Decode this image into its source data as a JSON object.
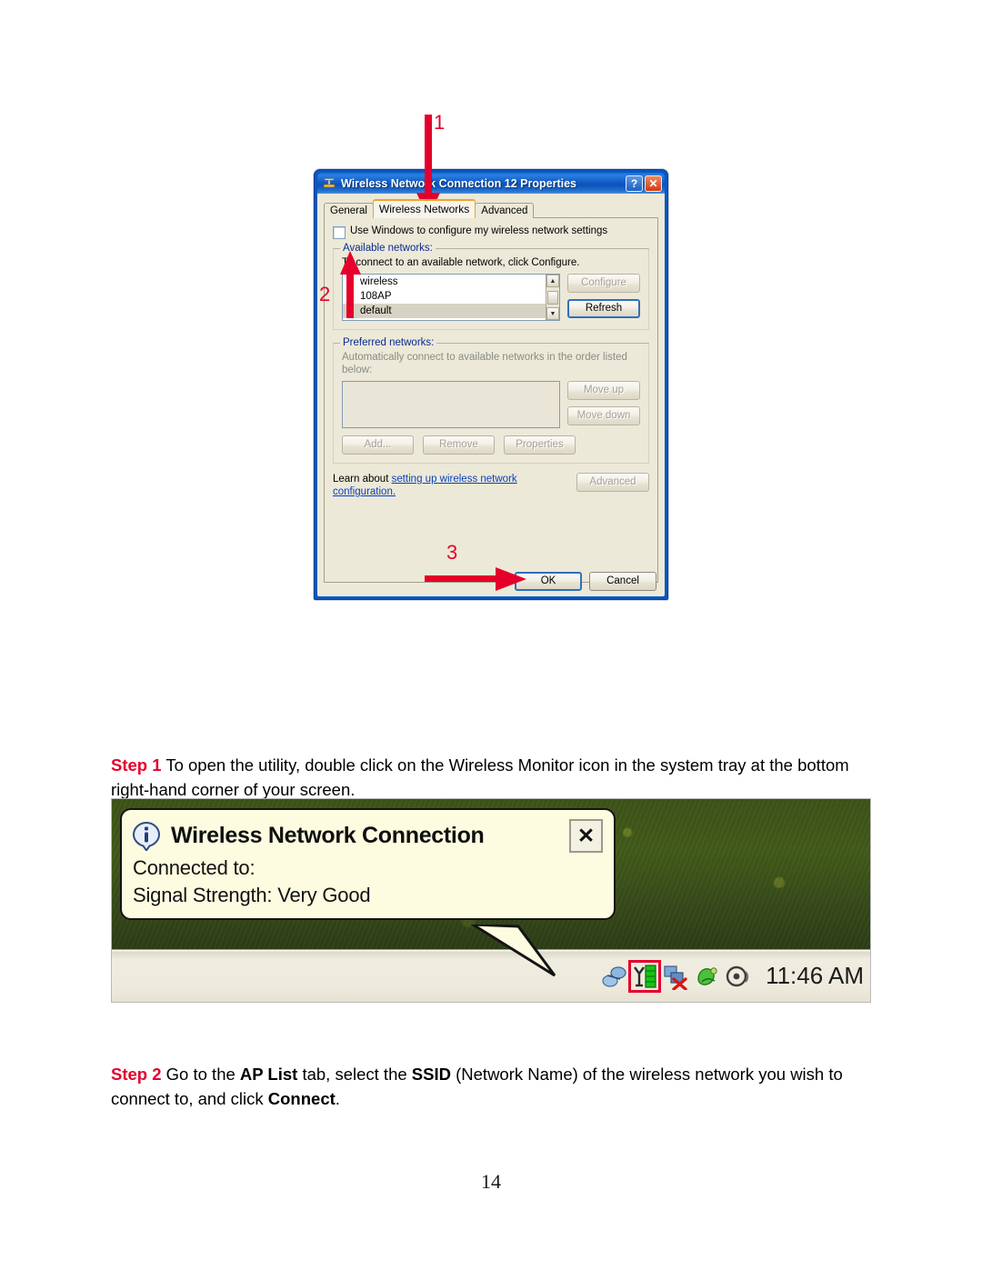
{
  "document": {
    "page_number": "14"
  },
  "figure_dialog": {
    "titlebar": {
      "title": "Wireless Network Connection 12 Properties",
      "icon": "network-adapter-icon",
      "help_button": "?",
      "close_button": "✕"
    },
    "tabs": [
      {
        "label": "General",
        "active": false
      },
      {
        "label": "Wireless Networks",
        "active": true
      },
      {
        "label": "Advanced",
        "active": false
      }
    ],
    "use_windows_checkbox": {
      "label": "Use Windows to configure my wireless network settings",
      "checked": false
    },
    "available_networks": {
      "legend": "Available networks:",
      "description": "To connect to an available network, click Configure.",
      "items": [
        {
          "name": "wireless",
          "icon": "antenna-icon",
          "selected": false
        },
        {
          "name": "108AP",
          "icon": "antenna-icon",
          "selected": false
        },
        {
          "name": "default",
          "icon": "antenna-active-icon",
          "selected": true
        }
      ],
      "buttons": [
        {
          "label": "Configure",
          "disabled": true
        },
        {
          "label": "Refresh",
          "disabled": false
        }
      ]
    },
    "preferred_networks": {
      "legend": "Preferred networks:",
      "description": "Automatically connect to available networks in the order listed below:",
      "items": [],
      "side_buttons": [
        {
          "label": "Move up",
          "disabled": true
        },
        {
          "label": "Move down",
          "disabled": true
        }
      ],
      "bottom_buttons": [
        {
          "label": "Add...",
          "disabled": true
        },
        {
          "label": "Remove",
          "disabled": true
        },
        {
          "label": "Properties",
          "disabled": true
        }
      ]
    },
    "learn_about": {
      "prefix": "Learn about ",
      "link": "setting up wireless network configuration.",
      "advanced_button": {
        "label": "Advanced",
        "disabled": true
      }
    },
    "footer_buttons": [
      {
        "label": "OK",
        "default": true
      },
      {
        "label": "Cancel",
        "default": false
      }
    ],
    "callouts": [
      {
        "number": "1",
        "target": "wireless-networks-tab"
      },
      {
        "number": "2",
        "target": "use-windows-checkbox"
      },
      {
        "number": "3",
        "target": "ok-button"
      }
    ],
    "callout_color": "#e4002b"
  },
  "steps": [
    {
      "label": "Step 1",
      "segments": [
        {
          "text": " To open the utility, double click on the Wireless Monitor icon in the system tray at the bottom right-hand corner of your screen.",
          "bold": false
        }
      ]
    },
    {
      "label": "Step 2",
      "segments": [
        {
          "text": " Go to the ",
          "bold": false
        },
        {
          "text": "AP List",
          "bold": true
        },
        {
          "text": " tab, select the ",
          "bold": false
        },
        {
          "text": "SSID",
          "bold": true
        },
        {
          "text": " (Network Name) of the wireless network you wish to connect to, and click ",
          "bold": false
        },
        {
          "text": "Connect",
          "bold": true
        },
        {
          "text": ".",
          "bold": false
        }
      ]
    }
  ],
  "figure_tray": {
    "balloon": {
      "icon": "info-icon",
      "title": "Wireless Network Connection",
      "close_button": "✕",
      "lines": [
        "Connected to:",
        "Signal Strength: Very Good"
      ]
    },
    "taskbar": {
      "clock": "11:46 AM",
      "tray_icons": [
        {
          "name": "network-connections-icon",
          "highlighted": false
        },
        {
          "name": "wireless-monitor-icon",
          "highlighted": true
        },
        {
          "name": "network-disconnected-icon",
          "highlighted": false
        },
        {
          "name": "antivirus-icon",
          "highlighted": false
        },
        {
          "name": "media-player-icon",
          "highlighted": false
        }
      ],
      "highlight_color": "#e4002b"
    }
  }
}
